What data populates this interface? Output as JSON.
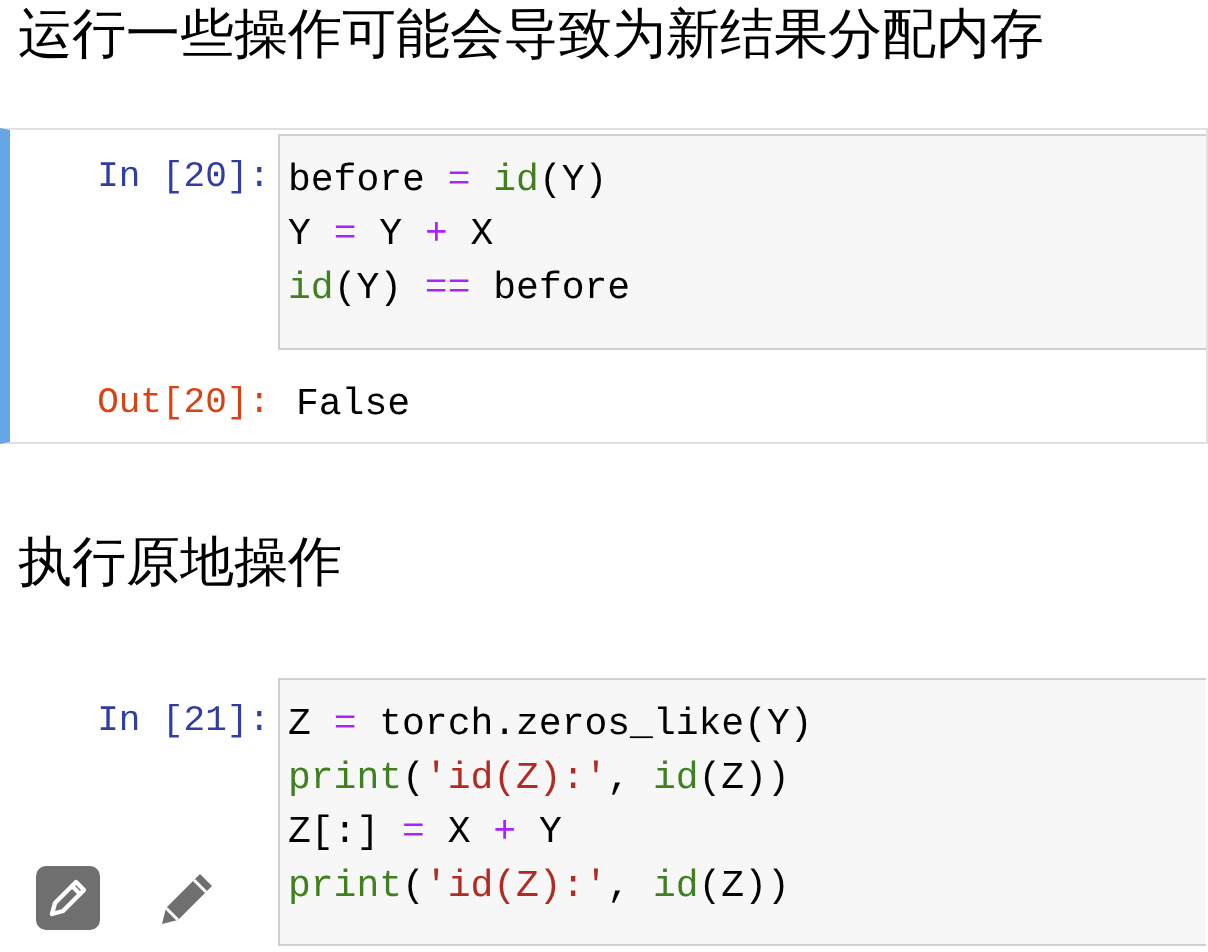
{
  "cells": [
    {
      "kind": "markdown",
      "text": "运行一些操作可能会导致为新结果分配内存"
    },
    {
      "kind": "code",
      "selected": true,
      "prompt": "In [20]:",
      "lines": [
        [
          {
            "text": "before ",
            "kind": "plain"
          },
          {
            "text": "= ",
            "kind": "op"
          },
          {
            "text": "id",
            "kind": "builtin"
          },
          {
            "text": "(Y)",
            "kind": "plain"
          }
        ],
        [
          {
            "text": "Y ",
            "kind": "plain"
          },
          {
            "text": "=",
            "kind": "op"
          },
          {
            "text": " Y ",
            "kind": "plain"
          },
          {
            "text": "+",
            "kind": "op"
          },
          {
            "text": " X",
            "kind": "plain"
          }
        ],
        [
          {
            "text": "id",
            "kind": "builtin"
          },
          {
            "text": "(Y) ",
            "kind": "plain"
          },
          {
            "text": "==",
            "kind": "op"
          },
          {
            "text": " before",
            "kind": "plain"
          }
        ]
      ],
      "output": {
        "prompt": "Out[20]:",
        "text": "False"
      }
    },
    {
      "kind": "markdown",
      "text": "执行原地操作"
    },
    {
      "kind": "code",
      "selected": false,
      "prompt": "In [21]:",
      "lines": [
        [
          {
            "text": "Z ",
            "kind": "plain"
          },
          {
            "text": "=",
            "kind": "op"
          },
          {
            "text": " torch.zeros_like(Y)",
            "kind": "plain"
          }
        ],
        [
          {
            "text": "print",
            "kind": "builtin"
          },
          {
            "text": "(",
            "kind": "plain"
          },
          {
            "text": "'id(Z):'",
            "kind": "string"
          },
          {
            "text": ", ",
            "kind": "plain"
          },
          {
            "text": "id",
            "kind": "builtin"
          },
          {
            "text": "(Z))",
            "kind": "plain"
          }
        ],
        [
          {
            "text": "Z[:] ",
            "kind": "plain"
          },
          {
            "text": "=",
            "kind": "op"
          },
          {
            "text": " X ",
            "kind": "plain"
          },
          {
            "text": "+",
            "kind": "op"
          },
          {
            "text": " Y",
            "kind": "plain"
          }
        ],
        [
          {
            "text": "print",
            "kind": "builtin"
          },
          {
            "text": "(",
            "kind": "plain"
          },
          {
            "text": "'id(Z):'",
            "kind": "string"
          },
          {
            "text": ", ",
            "kind": "plain"
          },
          {
            "text": "id",
            "kind": "builtin"
          },
          {
            "text": "(Z))",
            "kind": "plain"
          }
        ]
      ]
    }
  ]
}
